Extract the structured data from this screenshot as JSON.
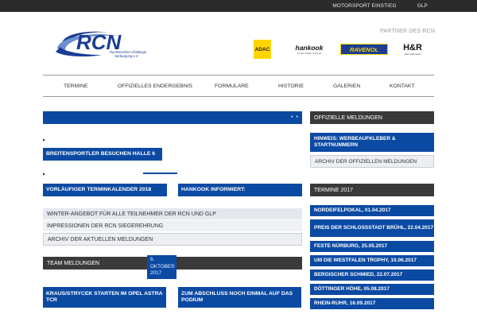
{
  "topbar": {
    "links": [
      "MOTORSPORT EINSTIEG",
      "GLP"
    ]
  },
  "header": {
    "logo_text": "RCN",
    "logo_subtitle_line1": "Rundstrecken-Challenge",
    "logo_subtitle_line2": "Nürburgring e.V.",
    "partner_label": "PARTNER DES RCN",
    "sponsors": {
      "adac": "ADAC",
      "hankook": "hankook",
      "hankook_sub": "Ventus Reifen & Pneus",
      "ravenol": "RAVENOL",
      "hr": "H&R",
      "hr_sub": "Das Federwerk"
    }
  },
  "nav": {
    "items": [
      "TERMINE",
      "OFFIZIELLES ENDERGEBNIS",
      "FORMULARE",
      "HISTORIE",
      "GALERIEN",
      "KONTAKT"
    ]
  },
  "main": {
    "slider_dots": "• •",
    "news_1": "BREITENSPORTLER BESUCHEN HALLE 6",
    "news_2": "VORLÄUFIGER TERMINKALENDER 2018",
    "news_3": "HANKOOK INFORMIERT:",
    "list": [
      "WINTER-ANGEBOT FÜR ALLE TEILNEHMER DER RCN UND GLP",
      "IMPRESSIONEN DER RCN SIEGEREHRUNG"
    ],
    "archive": "ARCHIV DER AKTUELLEN MELDUNGEN",
    "team_heading": "TEAM MELDUNGEN",
    "team_date": "6. OKTOBER 2017",
    "team_1": "KRAUS/STRYCEK STARTEN IM OPEL ASTRA TCR",
    "team_2": "ZUM ABSCHLUSS NOCH EINMAL AUF DAS PODIUM"
  },
  "sidebar": {
    "official_heading": "OFFIZIELLE MELDUNGEN",
    "official_item": "HINWEIS: WERBEAUFKLEBER & STARTNUMMERN",
    "official_archive": "ARCHIV DER OFFIZIELLEN MELDUNGEN",
    "termine_heading": "TERMINE 2017",
    "termine": [
      "NORDEIFELPOKAL, 01.04.2017",
      "PREIS DER SCHLOSSSTADT BRÜHL, 22.04.2017",
      "FESTE NÜRBURG, 25.05.2017",
      "UM DIE WESTFALEN TROPHY, 10.06.2017",
      "BERGISCHER SCHMIED, 22.07.2017",
      "DÖTTINGER HÖHE, 05.08.2017",
      "RHEIN-RUHR, 16.09.2017"
    ]
  },
  "colors": {
    "brand_blue": "#0b4aa3",
    "topbar": "#2b2b2b",
    "dark_heading": "#3a3a3a"
  }
}
